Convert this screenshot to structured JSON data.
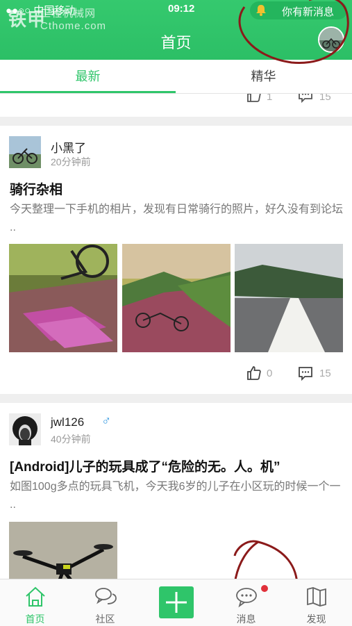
{
  "status_bar": {
    "carrier": "●●○○ 中国移动",
    "time": "09:12"
  },
  "watermark": {
    "main": "铁甲",
    "sub": "工程机械网",
    "domain": "Cthome.com"
  },
  "header": {
    "title": "首页",
    "notification": "你有新消息"
  },
  "tabs": [
    {
      "label": "最新",
      "active": true
    },
    {
      "label": "精华",
      "active": false
    }
  ],
  "previous_post": {
    "likes": "1",
    "comments": "15"
  },
  "posts": [
    {
      "author": "小黑了",
      "time": "20分钟前",
      "title": "骑行杂相",
      "excerpt": "今天整理一下手机的相片，发现有日常骑行的照片，好久没有到论坛 ..",
      "likes": "0",
      "comments": "15"
    },
    {
      "author": "jwl126",
      "gender": "♂",
      "time": "40分钟前",
      "title": "[Android]儿子的玩具成了“危险的无。人。机”",
      "excerpt": "如图100g多点的玩具飞机，今天我6岁的儿子在小区玩的时候一个一 .."
    }
  ],
  "bottom_nav": [
    {
      "label": "首页",
      "icon": "home-icon",
      "active": true
    },
    {
      "label": "社区",
      "icon": "chat-bubbles-icon",
      "active": false
    },
    {
      "label": "",
      "icon": "plus-icon",
      "active": false
    },
    {
      "label": "消息",
      "icon": "message-icon",
      "active": false,
      "badge": true
    },
    {
      "label": "发现",
      "icon": "map-icon",
      "active": false
    }
  ],
  "colors": {
    "accent": "#2fc56a",
    "badge": "#e0303a",
    "annotation": "#8b1a1a"
  }
}
